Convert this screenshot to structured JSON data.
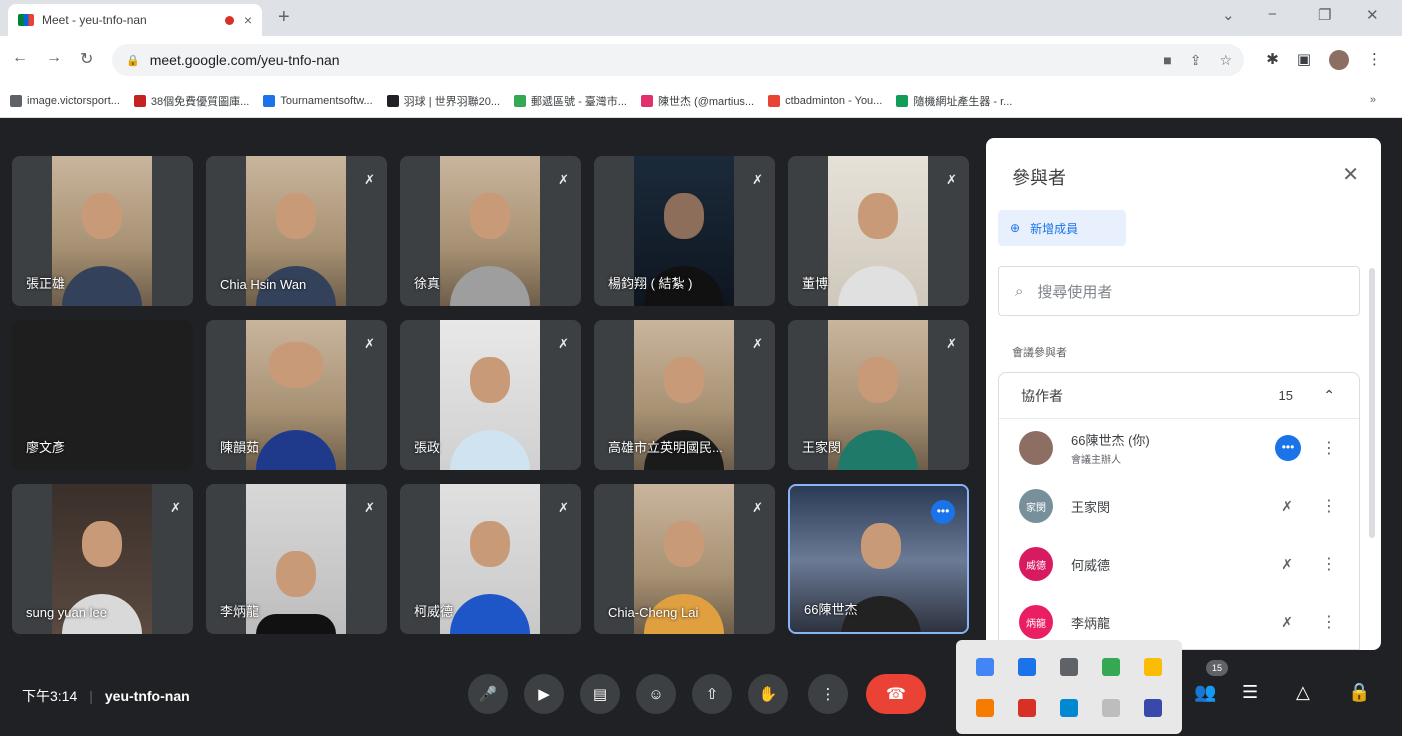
{
  "browser": {
    "tab_title": "Meet - yeu-tnfo-nan",
    "close_glyph": "×",
    "new_tab_glyph": "+",
    "url": "meet.google.com/yeu-tnfo-nan",
    "bookmarks": [
      {
        "label": "image.victorsport...",
        "color": "#5f6368"
      },
      {
        "label": "38個免費優質圖庫...",
        "color": "#c5221f"
      },
      {
        "label": "Tournamentsoftw...",
        "color": "#1a73e8"
      },
      {
        "label": "羽球 | 世界羽聯20...",
        "color": "#202124"
      },
      {
        "label": "郵遞區號 - 臺灣市...",
        "color": "#34a853"
      },
      {
        "label": "陳世杰 (@martius...",
        "color": "#e1306c"
      },
      {
        "label": "ctbadminton - You...",
        "color": "#ea4335"
      },
      {
        "label": "隨機網址產生器 - r...",
        "color": "#0f9d58"
      }
    ],
    "bookmarks_more": "»"
  },
  "participants_tiles": [
    {
      "name": "張正雄",
      "muted": false
    },
    {
      "name": "Chia Hsin Wan",
      "muted": true
    },
    {
      "name": "徐真",
      "muted": true
    },
    {
      "name": "楊鈞翔 ( 結紮 )",
      "muted": true
    },
    {
      "name": "董博",
      "muted": true
    },
    {
      "name": "廖文彥",
      "muted": false,
      "video_off": true
    },
    {
      "name": "陳韻茹",
      "muted": true
    },
    {
      "name": "張政",
      "muted": true
    },
    {
      "name": "高雄市立英明國民...",
      "muted": true
    },
    {
      "name": "王家閔",
      "muted": true
    },
    {
      "name": "sung yuan lee",
      "muted": true
    },
    {
      "name": "李炳龍",
      "muted": true
    },
    {
      "name": "柯威德",
      "muted": true
    },
    {
      "name": "Chia-Cheng Lai",
      "muted": true
    },
    {
      "name": "66陳世杰",
      "muted": false,
      "active": true
    }
  ],
  "panel": {
    "title": "參與者",
    "add_label": "新增成員",
    "search_placeholder": "搜尋使用者",
    "section_label": "會議參與者",
    "group_label": "協作者",
    "group_count": "15",
    "people": [
      {
        "name": "66陳世杰 (你)",
        "sub": "會議主辦人",
        "avatar_text": "",
        "avatar_color": "#8d6e63"
      },
      {
        "name": "王家閔",
        "sub": "",
        "avatar_text": "家閔",
        "avatar_color": "#78909c"
      },
      {
        "name": "何威德",
        "sub": "",
        "avatar_text": "威德",
        "avatar_color": "#d81b60"
      },
      {
        "name": "李炳龍",
        "sub": "",
        "avatar_text": "炳龍",
        "avatar_color": "#e91e63"
      }
    ]
  },
  "meeting": {
    "time": "下午3:14",
    "separator": "|",
    "code": "yeu-tnfo-nan",
    "participant_count": "15"
  },
  "icons": {
    "mute": "🎙",
    "more": "⋮",
    "close": "✕",
    "chevron_up": "⌃"
  }
}
